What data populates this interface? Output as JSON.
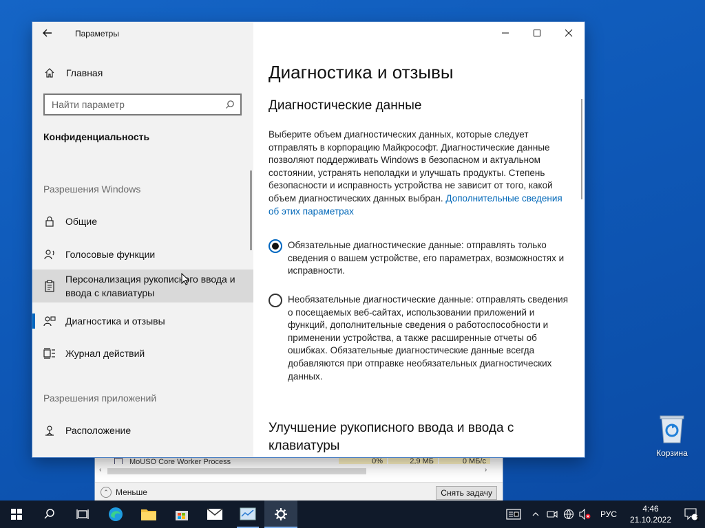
{
  "window": {
    "app_title": "Параметры",
    "back_icon": "back-arrow-icon",
    "minimize": "minimize",
    "maximize": "maximize",
    "close": "close"
  },
  "sidebar": {
    "home_label": "Главная",
    "search_placeholder": "Найти параметр",
    "section_title": "Конфиденциальность",
    "group_windows": "Разрешения Windows",
    "group_apps": "Разрешения приложений",
    "items": [
      {
        "label": "Общие",
        "icon": "lock-icon"
      },
      {
        "label": "Голосовые функции",
        "icon": "speech-icon"
      },
      {
        "label": "Персонализация рукописного ввода и ввода с клавиатуры",
        "icon": "clipboard-icon"
      },
      {
        "label": "Диагностика и отзывы",
        "icon": "feedback-icon"
      },
      {
        "label": "Журнал действий",
        "icon": "timeline-icon"
      },
      {
        "label": "Расположение",
        "icon": "location-icon"
      }
    ]
  },
  "main": {
    "title": "Диагностика и отзывы",
    "section_title": "Диагностические данные",
    "description": "Выберите объем диагностических данных, которые следует отправлять в корпорацию Майкрософт. Диагностические данные позволяют поддерживать Windows в безопасном и актуальном состоянии, устранять неполадки и улучшать продукты. Степень безопасности и исправность устройства не зависит от того, какой объем диагностических данных выбран.",
    "link": "Дополнительные сведения об этих параметрах",
    "options": [
      {
        "label": "Обязательные диагностические данные: отправлять только сведения о вашем устройстве, его параметрах, возможностях и исправности.",
        "checked": true
      },
      {
        "label": "Необязательные диагностические данные: отправлять сведения о посещаемых веб-сайтах, использовании приложений и функций, дополнительные сведения о работоспособности и применении устройства, а также расширенные отчеты об ошибках. Обязательные диагностические данные всегда добавляются при отправке необязательных диагностических данных.",
        "checked": false
      }
    ],
    "section2_title": "Улучшение рукописного ввода и ввода с клавиатуры"
  },
  "task_manager": {
    "process_name": "MoUSO Core Worker Process",
    "cpu": "0%",
    "memory": "2,9 МБ",
    "disk": "0 МБ/с",
    "less_label": "Меньше",
    "end_task_label": "Снять задачу"
  },
  "desktop": {
    "recycle_bin_label": "Корзина"
  },
  "taskbar": {
    "language": "РУС",
    "time": "4:46",
    "date": "21.10.2022",
    "notification_count": "1"
  },
  "colors": {
    "accent": "#0067c0",
    "link": "#0067b8",
    "desktop": "#1060c0",
    "taskbar": "#101a2a"
  }
}
